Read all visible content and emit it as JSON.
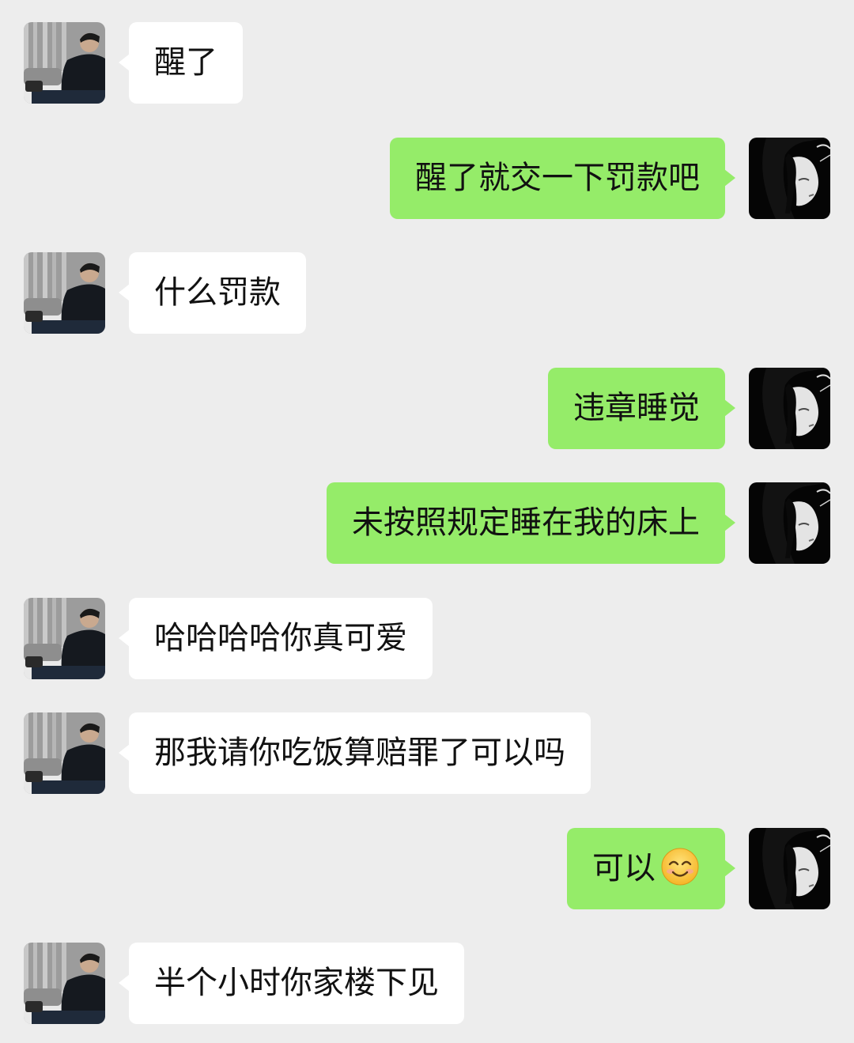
{
  "colors": {
    "background": "#ededed",
    "incoming_bubble": "#ffffff",
    "outgoing_bubble": "#95ec69",
    "text": "#111111"
  },
  "contact_avatar_icon": "avatar-man-sitting-photo",
  "self_avatar_icon": "avatar-anime-girl-dark",
  "messages": [
    {
      "from": "contact",
      "text": "醒了"
    },
    {
      "from": "self",
      "text": "醒了就交一下罚款吧"
    },
    {
      "from": "contact",
      "text": "什么罚款"
    },
    {
      "from": "self",
      "text": "违章睡觉"
    },
    {
      "from": "self",
      "text": "未按照规定睡在我的床上"
    },
    {
      "from": "contact",
      "text": "哈哈哈哈你真可爱"
    },
    {
      "from": "contact",
      "text": "那我请你吃饭算赔罪了可以吗"
    },
    {
      "from": "self",
      "text": "可以",
      "emoji": "smiling-face-emoji"
    },
    {
      "from": "contact",
      "text": "半个小时你家楼下见"
    }
  ]
}
